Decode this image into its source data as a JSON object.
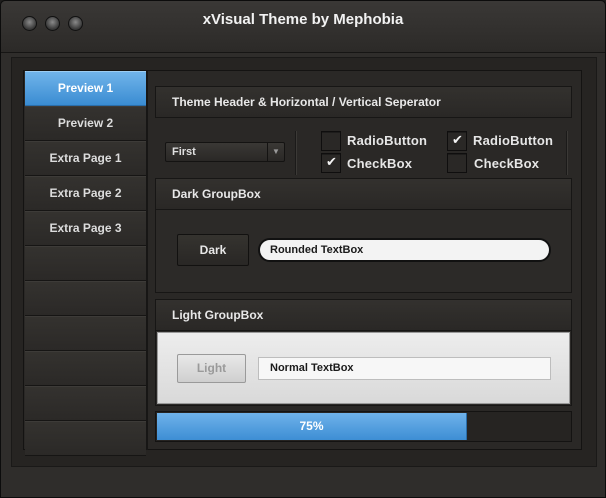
{
  "window": {
    "title": "xVisual Theme by Mephobia"
  },
  "sidebar": {
    "items": [
      {
        "label": "Preview 1",
        "active": true
      },
      {
        "label": "Preview 2",
        "active": false
      },
      {
        "label": "Extra Page 1",
        "active": false
      },
      {
        "label": "Extra Page 2",
        "active": false
      },
      {
        "label": "Extra Page 3",
        "active": false
      },
      {
        "label": "",
        "active": false
      },
      {
        "label": "",
        "active": false
      },
      {
        "label": "",
        "active": false
      },
      {
        "label": "",
        "active": false
      },
      {
        "label": "",
        "active": false
      },
      {
        "label": "",
        "active": false
      }
    ]
  },
  "main": {
    "header": "Theme Header & Horizontal / Vertical Seperator",
    "combo": {
      "selected": "First"
    },
    "options": {
      "radio_left_label": "RadioButton",
      "radio_left_checked": false,
      "radio_right_label": "RadioButton",
      "radio_right_checked": true,
      "check_left_label": "CheckBox",
      "check_left_checked": true,
      "check_right_label": "CheckBox",
      "check_right_checked": false
    },
    "dark_group": {
      "title": "Dark GroupBox",
      "button": "Dark",
      "textbox_value": "Rounded TextBox"
    },
    "light_group": {
      "title": "Light GroupBox",
      "button": "Light",
      "textbox_value": "Normal TextBox"
    },
    "progress": {
      "value": 75,
      "label": "75%"
    }
  },
  "colors": {
    "accent": "#4a98db",
    "background": "#2f2d2b"
  },
  "icons": {
    "check": "check-mark-icon",
    "dropdown": "chevron-down-icon"
  }
}
